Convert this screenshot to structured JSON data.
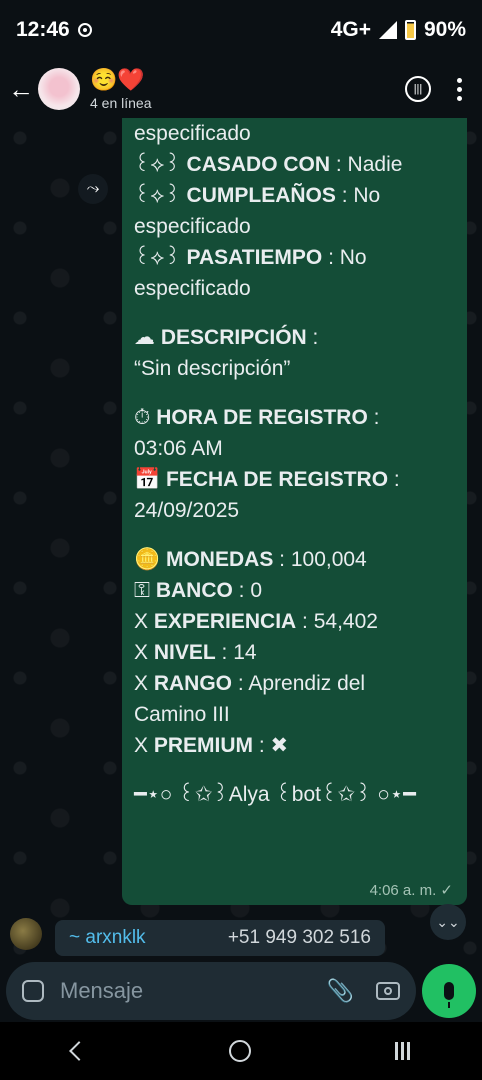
{
  "status": {
    "time": "12:46",
    "network": "4G+",
    "battery": "90%"
  },
  "header": {
    "title": "☺️❤️",
    "subtitle": "4 en línea"
  },
  "message": {
    "lines": [
      {
        "label": "",
        "value": "especificado"
      },
      {
        "label": "CASADO CON",
        "value": " : Nadie",
        "prefix": "꒰⟡꒱ "
      },
      {
        "label": "CUMPLEAÑOS",
        "value": " : No",
        "prefix": "꒰⟡꒱ "
      },
      {
        "label": "",
        "value": "especificado"
      },
      {
        "label": "PASATIEMPO",
        "value": " : No",
        "prefix": "꒰⟡꒱ "
      },
      {
        "label": "",
        "value": "especificado"
      },
      {
        "label": "",
        "value": ""
      },
      {
        "label": "DESCRIPCIÓN",
        "value": " :",
        "prefix": "☁ "
      },
      {
        "label": "",
        "value": "“Sin descripción”"
      },
      {
        "label": "",
        "value": ""
      },
      {
        "label": "HORA DE REGISTRO",
        "value": " :",
        "prefix": "⏱ "
      },
      {
        "label": "",
        "value": "03:06 AM"
      },
      {
        "label": "FECHA DE REGISTRO",
        "value": " :",
        "prefix": "📅 "
      },
      {
        "label": "",
        "value": "24/09/2025"
      },
      {
        "label": "",
        "value": ""
      },
      {
        "label": "MONEDAS",
        "value": " : 100,004",
        "prefix": "🪙 "
      },
      {
        "label": "BANCO",
        "value": " : 0",
        "prefix": "⚿ "
      },
      {
        "label": "EXPERIENCIA",
        "value": " : 54,402",
        "prefix": "X "
      },
      {
        "label": "NIVEL",
        "value": " : 14",
        "prefix": "X "
      },
      {
        "label": "RANGO",
        "value": " : Aprendiz del",
        "prefix": "X "
      },
      {
        "label": "",
        "value": "Camino III"
      },
      {
        "label": "PREMIUM",
        "value": " : ✖",
        "prefix": "X "
      },
      {
        "label": "",
        "value": ""
      },
      {
        "label": "",
        "value": "━⋆○ ꒰✩꒱Alya ꒰bot꒰✩꒱ ○⋆━"
      }
    ],
    "time": "4:06 a. m. ✓"
  },
  "preview": {
    "name": "~ arxnklk",
    "phone": "+51 949 302 516"
  },
  "input": {
    "placeholder": "Mensaje"
  }
}
